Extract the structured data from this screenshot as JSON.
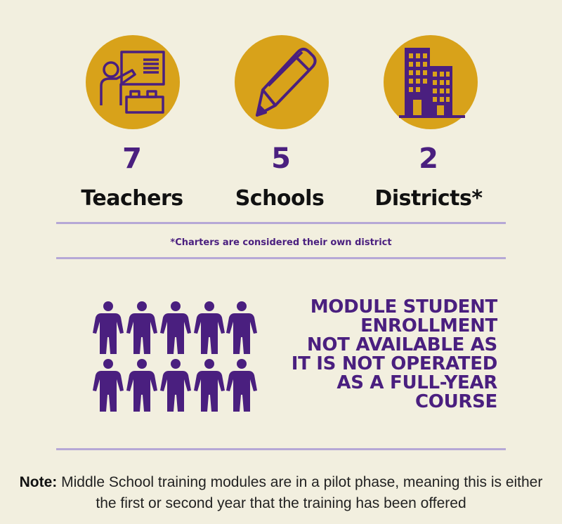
{
  "stats": [
    {
      "number": "7",
      "label": "Teachers",
      "icon": "teacher-board-icon"
    },
    {
      "number": "5",
      "label": "Schools",
      "icon": "pencil-icon"
    },
    {
      "number": "2",
      "label": "Districts*",
      "icon": "buildings-icon"
    }
  ],
  "footnote": "*Charters are considered their own district",
  "enrollment_message": {
    "lines": [
      "MODULE STUDENT",
      "ENROLLMENT",
      "NOT AVAILABLE AS",
      "IT IS NOT OPERATED",
      "AS A FULL-YEAR",
      "COURSE"
    ],
    "icon": "people-group-icon"
  },
  "note": {
    "label": "Note:",
    "text": " Middle School training modules are in a pilot phase, meaning this is either the first or second year that the training has been offered"
  },
  "colors": {
    "background": "#f2efdf",
    "gold": "#d8a21a",
    "purple": "#4a1f7f",
    "divider": "#b6a8d6"
  }
}
